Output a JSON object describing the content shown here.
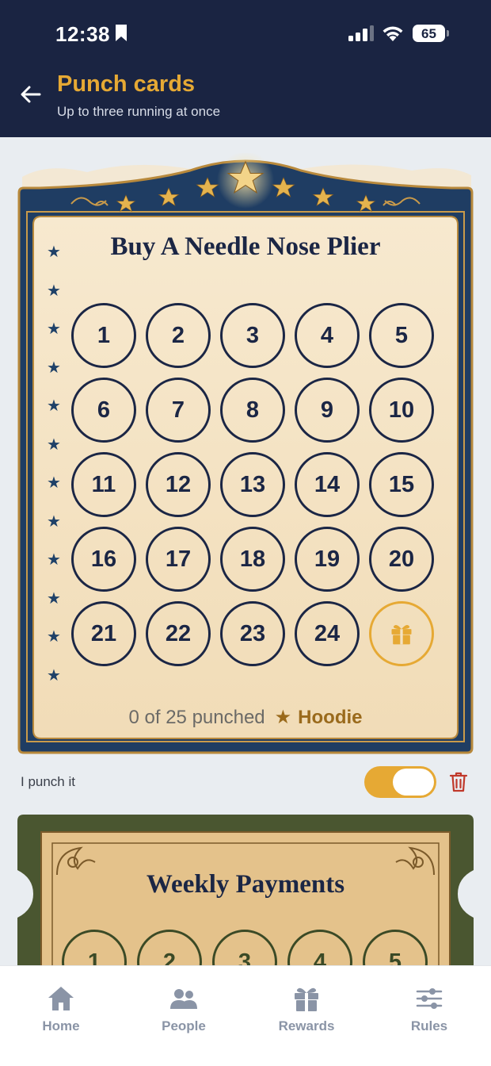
{
  "status_bar": {
    "time": "12:38",
    "battery": "65"
  },
  "header": {
    "title": "Punch cards",
    "subtitle": "Up to three running at once"
  },
  "card1": {
    "title": "Buy A Needle Nose Plier",
    "punches": [
      "1",
      "2",
      "3",
      "4",
      "5",
      "6",
      "7",
      "8",
      "9",
      "10",
      "11",
      "12",
      "13",
      "14",
      "15",
      "16",
      "17",
      "18",
      "19",
      "20",
      "21",
      "22",
      "23",
      "24"
    ],
    "reward_icon": "gift-icon",
    "count_text": "0 of 25 punched",
    "prize": "Hoodie",
    "star_glyph": "★"
  },
  "punch_row": {
    "label": "I punch it",
    "toggle_on": true
  },
  "card2": {
    "title": "Weekly Payments",
    "punches": [
      "1",
      "2",
      "3",
      "4",
      "5"
    ]
  },
  "nav": {
    "items": [
      {
        "label": "Home",
        "icon": "home-icon"
      },
      {
        "label": "People",
        "icon": "people-icon"
      },
      {
        "label": "Rewards",
        "icon": "gift-icon"
      },
      {
        "label": "Rules",
        "icon": "sliders-icon"
      }
    ]
  },
  "colors": {
    "header_bg": "#1a2442",
    "accent": "#e6a934",
    "navy": "#1b2645",
    "danger": "#c0392b"
  }
}
